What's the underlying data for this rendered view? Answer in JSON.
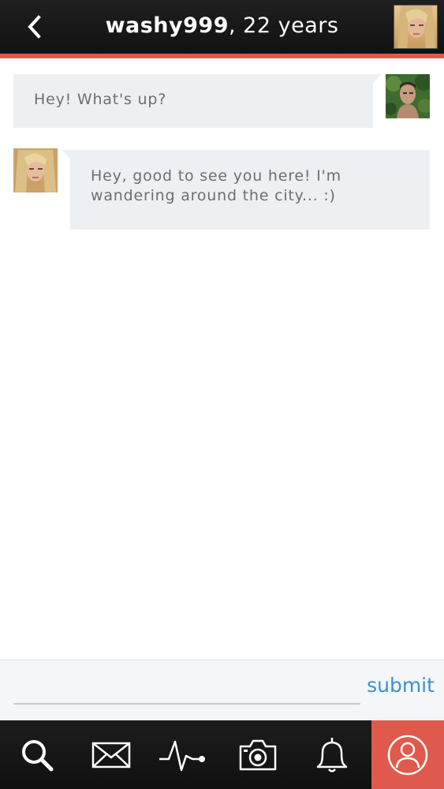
{
  "header": {
    "username": "washy999",
    "age_text": ", 22 years",
    "back_icon": "chevron-left-icon",
    "accent_color": "#df5a4c"
  },
  "messages": [
    {
      "sender": "me",
      "text": "Hey! What's up?"
    },
    {
      "sender": "washy999",
      "text": "Hey, good to see you here! I'm wandering around the city... :)"
    }
  ],
  "composer": {
    "placeholder": "",
    "value": "",
    "submit_label": "submit",
    "submit_color": "#3a8fd6"
  },
  "bottom_nav": {
    "items": [
      {
        "icon": "search-icon",
        "active": false
      },
      {
        "icon": "envelope-icon",
        "active": false
      },
      {
        "icon": "activity-pulse-icon",
        "active": false
      },
      {
        "icon": "camera-icon",
        "active": false
      },
      {
        "icon": "bell-icon",
        "active": false
      },
      {
        "icon": "profile-icon",
        "active": true
      }
    ],
    "active_color": "#df5a4c"
  }
}
